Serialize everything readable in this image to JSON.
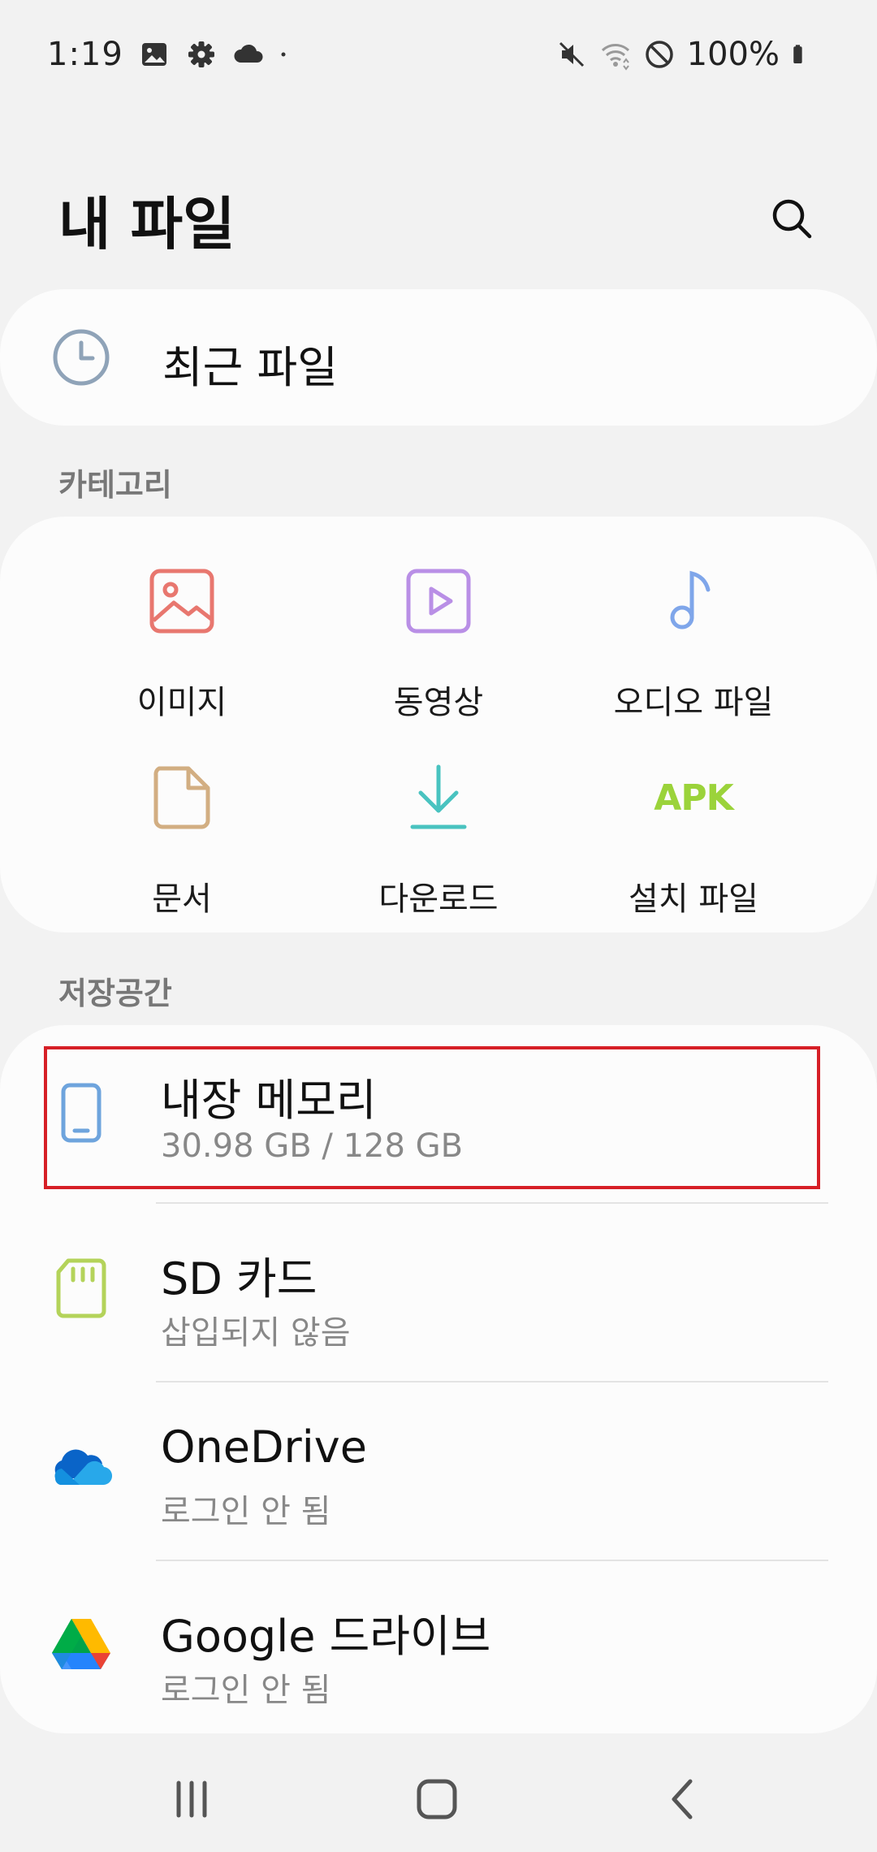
{
  "status_bar": {
    "time": "1:19",
    "left_icons": [
      "gallery-icon",
      "settings-icon",
      "cloud-icon",
      "dot-icon"
    ],
    "right_icons": [
      "mute-icon",
      "wifi-icon",
      "do-not-disturb-icon",
      "battery-icon"
    ],
    "battery": "100%"
  },
  "header": {
    "title": "내 파일",
    "search_icon": "search-icon"
  },
  "recent": {
    "label": "최근 파일",
    "icon": "clock-icon"
  },
  "categories": {
    "section_title": "카테고리",
    "items": [
      {
        "label": "이미지",
        "icon": "image-icon",
        "color": "#e8776f"
      },
      {
        "label": "동영상",
        "icon": "video-icon",
        "color": "#b98fe6"
      },
      {
        "label": "오디오 파일",
        "icon": "music-note-icon",
        "color": "#7fa6ea"
      },
      {
        "label": "문서",
        "icon": "document-icon",
        "color": "#d2ae82"
      },
      {
        "label": "다운로드",
        "icon": "download-icon",
        "color": "#49c3c0"
      },
      {
        "label": "설치 파일",
        "icon_text": "APK",
        "icon": "apk-icon",
        "color": "#9bd33a"
      }
    ]
  },
  "storage": {
    "section_title": "저장공간",
    "items": [
      {
        "name": "내장 메모리",
        "detail": "30.98 GB / 128 GB",
        "icon": "phone-icon",
        "color": "#6ea4dd",
        "highlighted": true
      },
      {
        "name": "SD 카드",
        "detail": "삽입되지 않음",
        "icon": "sd-card-icon",
        "color": "#b4d35a"
      },
      {
        "name": "OneDrive",
        "detail": "로그인 안 됨",
        "icon": "onedrive-icon",
        "color": "#1e78d4"
      },
      {
        "name": "Google 드라이브",
        "detail": "로그인 안 됨",
        "icon": "google-drive-icon",
        "color": "#1ea362"
      }
    ]
  },
  "nav_bar": {
    "buttons": [
      "recent-apps-icon",
      "home-icon",
      "back-icon"
    ]
  }
}
